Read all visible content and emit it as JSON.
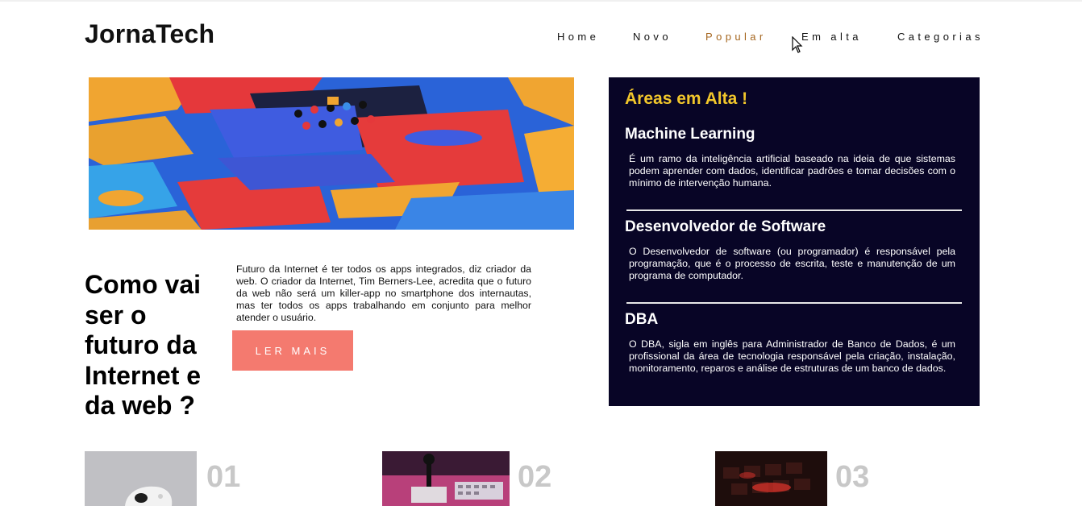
{
  "brand": {
    "logo": "JornaTech"
  },
  "nav": {
    "items": [
      {
        "label": "Home",
        "active": false
      },
      {
        "label": "Novo",
        "active": false
      },
      {
        "label": "Popular",
        "active": true
      },
      {
        "label": "Em alta",
        "active": false
      },
      {
        "label": "Categorias",
        "active": false
      }
    ]
  },
  "colors": {
    "accent": "#a5661f",
    "button": "#f47a6f",
    "panel_bg": "#080526",
    "panel_heading": "#f2c72b"
  },
  "featured": {
    "title": "Como vai ser o futuro da Internet e da web ?",
    "excerpt": "Futuro da Internet é ter todos os apps integrados, diz criador da web. O criador da Internet, Tim Berners-Lee, acredita que o futuro da web não será um killer-app no smartphone dos internautas, mas ter todos os apps trabalhando em conjunto para melhor atender o usuário.",
    "button_label": "LER MAIS"
  },
  "trending": {
    "heading": "Áreas em Alta !",
    "areas": [
      {
        "title": "Machine Learning",
        "description": "É um ramo da inteligência artificial baseado na ideia de que sistemas podem aprender com dados, identificar padrões e tomar decisões com o mínimo de intervenção humana."
      },
      {
        "title": "Desenvolvedor de Software",
        "description": "O Desenvolvedor de software (ou programador) é responsável pela programação, que é o processo de escrita, teste e manutenção de um programa de computador."
      },
      {
        "title": "DBA",
        "description": "O DBA, sigla em inglês para Administrador de Banco de Dados, é um profissional da área de tecnologia responsável pela criação, instalação, monitoramento, reparos e análise de estruturas de um banco de dados."
      }
    ]
  },
  "cards": [
    {
      "number": "01"
    },
    {
      "number": "02"
    },
    {
      "number": "03"
    }
  ]
}
